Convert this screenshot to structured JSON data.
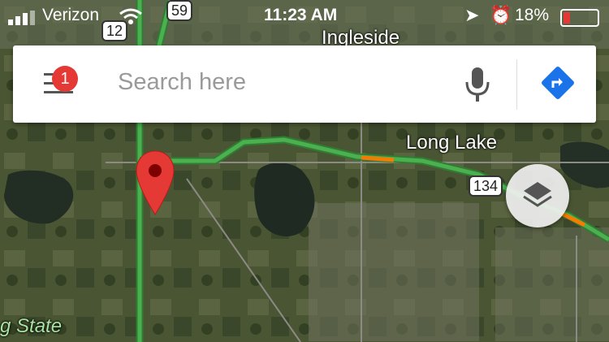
{
  "status_bar": {
    "carrier": "Verizon",
    "time": "11:23 AM",
    "battery": "18%"
  },
  "search": {
    "placeholder": "Search here",
    "menu_badge": "1"
  },
  "map_labels": {
    "ingleside": "Ingleside",
    "long_lake": "Long Lake",
    "state_park": "g State"
  },
  "route_shields": {
    "r12": "12",
    "r59": "59",
    "r134": "134"
  },
  "colors": {
    "traffic_clear": "#4caf50",
    "traffic_slow": "#f57c00",
    "pin": "#e53935",
    "directions": "#1a73e8"
  },
  "icons": [
    "menu-icon",
    "mic-icon",
    "directions-icon",
    "layers-icon",
    "map-pin-icon",
    "wifi-icon",
    "location-arrow-icon",
    "alarm-icon",
    "battery-icon"
  ]
}
